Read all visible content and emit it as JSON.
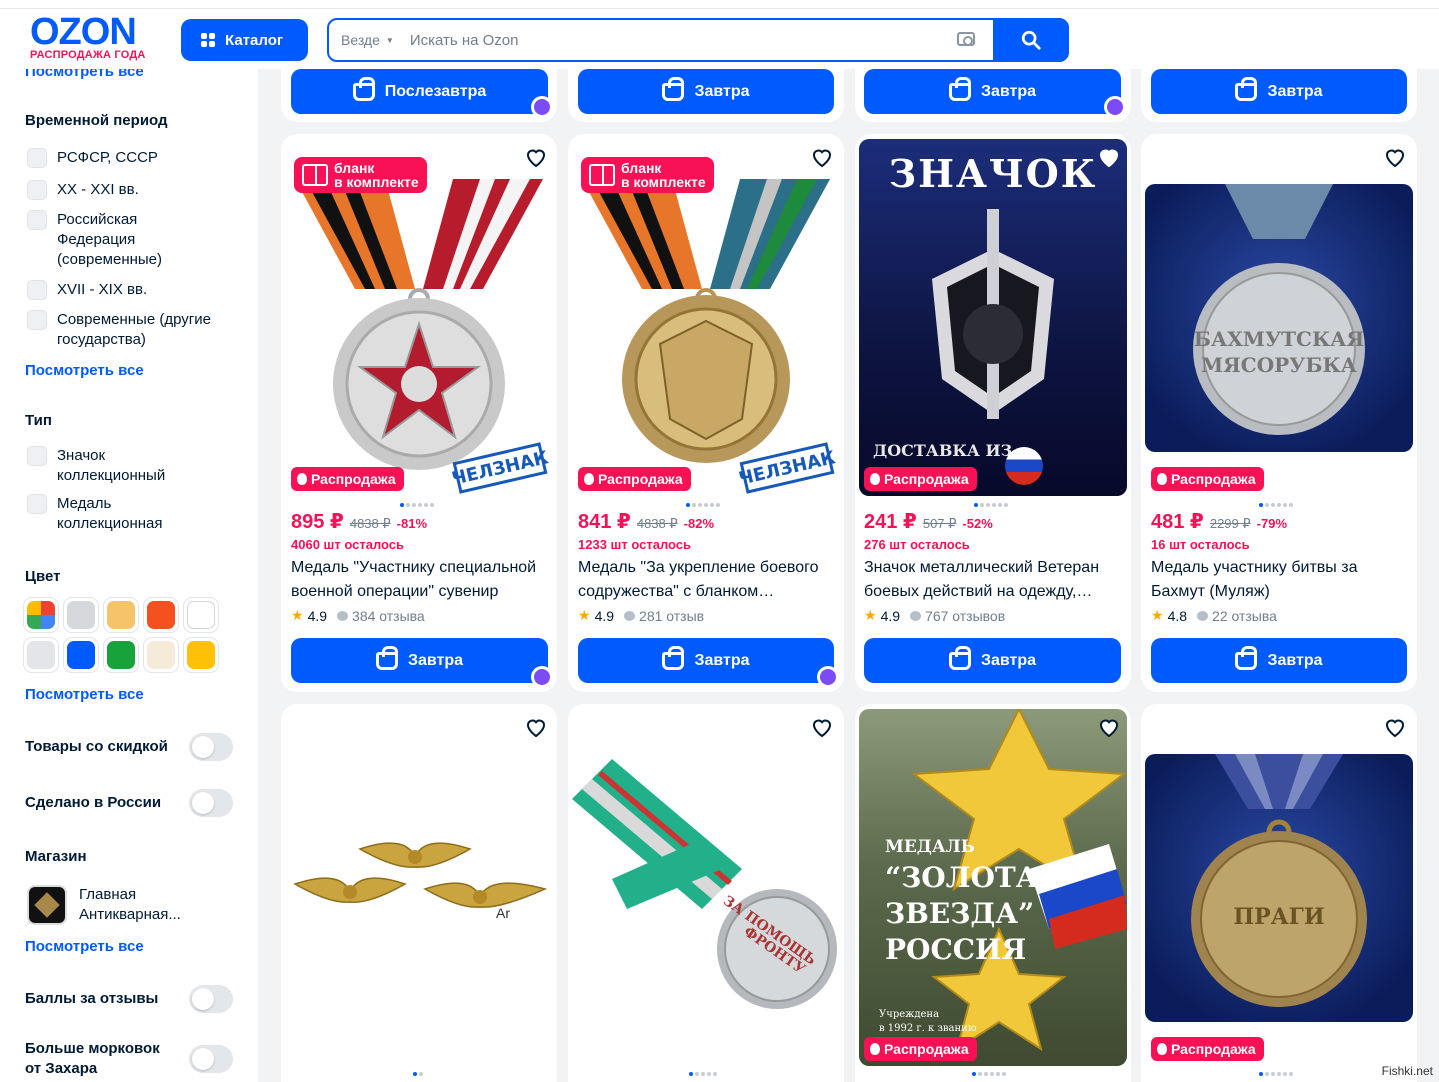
{
  "header": {
    "logo_text": "OZON",
    "logo_subtitle": "РАСПРОДАЖА ГОДА",
    "catalog_label": "Каталог",
    "search_scope": "Везде",
    "search_placeholder": "Искать на Ozon"
  },
  "sidebar": {
    "see_all_top": "Посмотреть все",
    "period_title": "Временной период",
    "period_items": [
      "РСФСР, СССР",
      "XX - XXI вв.",
      "Российская Федерация (современные)",
      "XVII - XIX вв.",
      "Современные (другие государства)"
    ],
    "see_all_1": "Посмотреть все",
    "type_title": "Тип",
    "type_items": [
      "Значок коллекционный",
      "Медаль коллекционная"
    ],
    "color_title": "Цвет",
    "colors": [
      "multicolor",
      "#d6d8db",
      "#f5c46a",
      "#f4511e",
      "#ffffff",
      "#e3e5e8",
      "#005bff",
      "#18a23c",
      "#f6ead8",
      "#ffc107"
    ],
    "see_all_2": "Посмотреть все",
    "discount_label": "Товары со скидкой",
    "russia_label": "Сделано в России",
    "shop_title": "Магазин",
    "shop_name": "Главная Антикварная...",
    "see_all_3": "Посмотреть все",
    "points_label": "Баллы за отзывы",
    "carrots_label": "Больше морковок от Захара"
  },
  "top_buttons": [
    "Послезавтра",
    "Завтра",
    "Завтра",
    "Завтра"
  ],
  "products": [
    {
      "blank_badge": [
        "бланк",
        "в комплекте"
      ],
      "stamp": "ЧЕЛЗНАК",
      "sale": "Распродажа",
      "price": "895 ₽",
      "old_price": "4838 ₽",
      "discount": "-81%",
      "stock": "4060 шт осталось",
      "title": "Медаль \"Участнику специальной военной операции\" сувенир",
      "rating": "4.9",
      "reviews": "384 отзыва",
      "button": "Завтра"
    },
    {
      "blank_badge": [
        "бланк",
        "в комплекте"
      ],
      "stamp": "ЧЕЛЗНАК",
      "sale": "Распродажа",
      "price": "841 ₽",
      "old_price": "4838 ₽",
      "discount": "-82%",
      "stock": "1233 шт осталось",
      "title": "Медаль \"За укрепление боевого содружества\" с бланком…",
      "rating": "4.9",
      "reviews": "281 отзыв",
      "button": "Завтра"
    },
    {
      "img_title": "ЗНАЧОК",
      "img_delivery": "ДОСТАВКА ИЗ",
      "sale": "Распродажа",
      "price": "241 ₽",
      "old_price": "507 ₽",
      "discount": "-52%",
      "stock": "276 шт осталось",
      "title": "Значок металлический Ветеран боевых действий на одежду,…",
      "rating": "4.9",
      "reviews": "767 отзывов",
      "button": "Завтра"
    },
    {
      "sale": "Распродажа",
      "price": "481 ₽",
      "old_price": "2299 ₽",
      "discount": "-79%",
      "stock": "16 шт осталось",
      "title": "Медаль участнику битвы за Бахмут (Муляж)",
      "rating": "4.8",
      "reviews": "22 отзыва",
      "button": "Завтра"
    }
  ],
  "row2": [
    {
      "img_mark": "Ar"
    },
    {},
    {
      "img_lines": [
        "МЕДАЛЬ",
        "“ЗОЛОТАЯ",
        "ЗВЕЗДА”",
        "РОССИЯ"
      ],
      "img_small": [
        "Учреждена",
        "в 1992 г. к званию"
      ],
      "sale": "Распродажа"
    },
    {
      "sale": "Распродажа"
    }
  ],
  "watermark": "Fishki.net"
}
